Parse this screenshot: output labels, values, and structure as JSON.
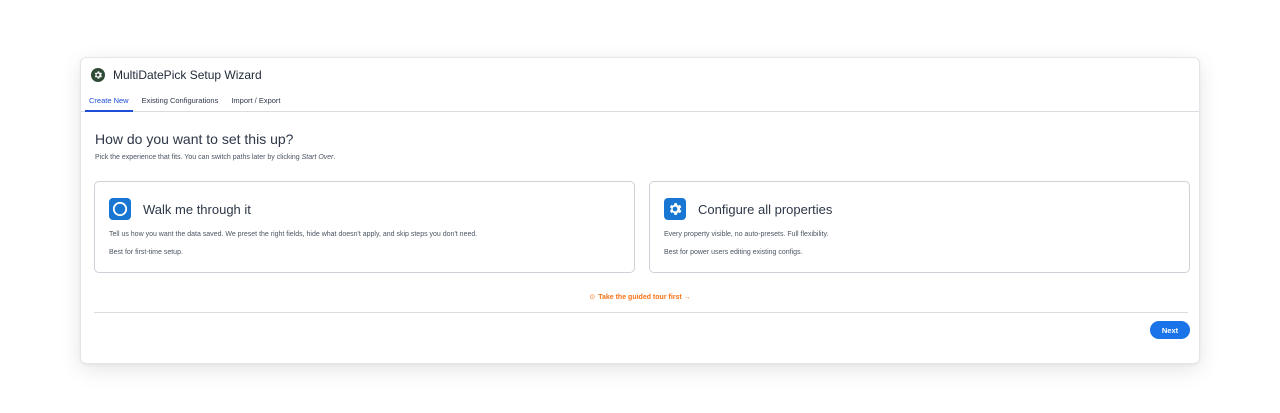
{
  "window": {
    "title": "MultiDatePick Setup Wizard"
  },
  "tabs": [
    {
      "label": "Create New"
    },
    {
      "label": "Existing Configurations"
    },
    {
      "label": "Import / Export"
    }
  ],
  "main": {
    "heading": "How do you want to set this up?",
    "subheading_prefix": "Pick the experience that fits. You can switch paths later by clicking ",
    "subheading_emphasis": "Start Over",
    "subheading_suffix": "."
  },
  "cards": [
    {
      "icon": "circle-icon",
      "title": "Walk me through it",
      "description": "Tell us how you want the data saved. We preset the right fields, hide what doesn't apply, and skip steps you don't need.",
      "note": "Best for first-time setup."
    },
    {
      "icon": "gear-icon",
      "title": "Configure all properties",
      "description": "Every property visible, no auto-presets. Full flexibility.",
      "note": "Best for power users editing existing configs."
    }
  ],
  "tour_link": {
    "icon": "target-icon",
    "label": "Take the guided tour first →"
  },
  "footer": {
    "next_label": "Next"
  },
  "colors": {
    "accent": "#1a73e8",
    "tab_active": "#1d4ed8",
    "tour": "#f97316",
    "app_icon": "#2e4b36"
  }
}
